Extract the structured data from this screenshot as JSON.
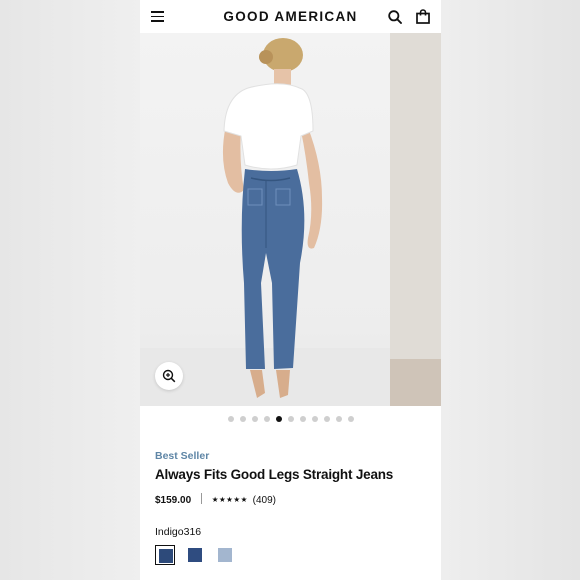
{
  "header": {
    "brand": "GOOD AMERICAN",
    "icons": [
      "menu-icon",
      "search-icon",
      "bag-icon"
    ]
  },
  "gallery": {
    "image_count": 11,
    "active_index": 4,
    "zoom_icon": "zoom-in-icon"
  },
  "product": {
    "badge": "Best Seller",
    "title": "Always Fits Good Legs Straight Jeans",
    "price": "$159.00",
    "stars": "★★★★★",
    "reviews": "(409)"
  },
  "shades": {
    "selected_name": "Indigo316",
    "swatches": [
      {
        "name": "indigo",
        "color": "#2d4a7a",
        "selected": true
      },
      {
        "name": "dark-blue",
        "color": "#2f4c80",
        "selected": false
      },
      {
        "name": "light-blue",
        "color": "#a3b6cf",
        "selected": false
      }
    ]
  },
  "colors": {
    "accent": "#5f86a6",
    "text": "#111111",
    "denim": "#4a6d9c"
  }
}
